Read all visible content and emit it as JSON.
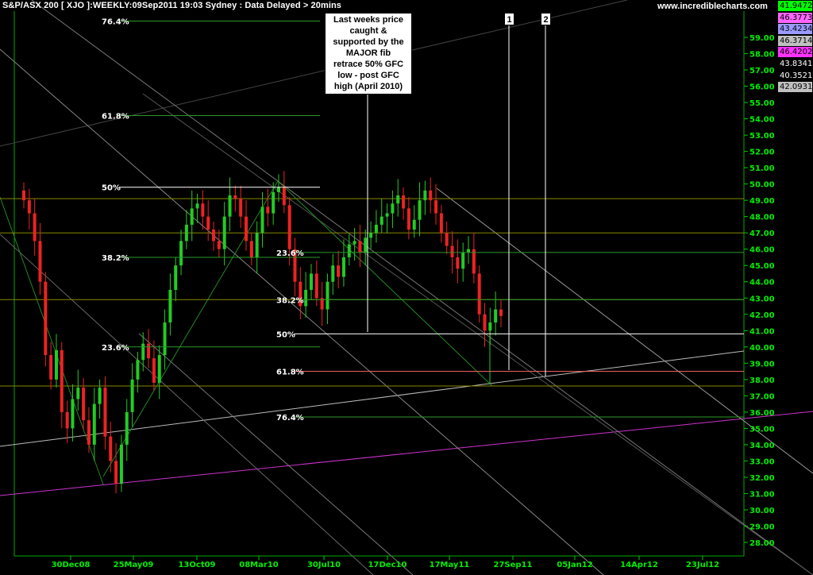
{
  "header": {
    "title": "S&P/ASX 200 [ XJO ]:WEEKLY:09Sep2011 19:03 Sydney : Data Delayed > 20mins",
    "site": "www.incrediblecharts.com"
  },
  "annotation": {
    "lines": [
      "Last weeks price",
      "caught &",
      "supported by the",
      "MAJOR fib",
      "retrace 50% GFC",
      "low - post GFC",
      "high (April 2010)"
    ]
  },
  "markers": [
    "1",
    "2"
  ],
  "price_boxes": [
    {
      "value": "41.9472",
      "color": "#00ff00"
    },
    {
      "value": "46.3773",
      "color": "#ff66ff"
    },
    {
      "value": "43.4234",
      "color": "#9999ff"
    },
    {
      "value": "46.3714",
      "color": "#c0c0c0"
    },
    {
      "value": "46.4202",
      "color": "#ff33ff"
    },
    {
      "value": "43.8341",
      "color": "#000000"
    },
    {
      "value": "40.3521",
      "color": "#000000"
    },
    {
      "value": "42.0931",
      "color": "#c0c0c0"
    }
  ],
  "chart_data": {
    "type": "candlestick",
    "ylim": [
      27.5,
      61.0
    ],
    "y_ticks": [
      "28.00",
      "29.00",
      "30.00",
      "31.00",
      "32.00",
      "33.00",
      "34.00",
      "35.00",
      "36.00",
      "37.00",
      "38.00",
      "39.00",
      "40.00",
      "41.00",
      "42.00",
      "43.00",
      "44.00",
      "45.00",
      "46.00",
      "47.00",
      "48.00",
      "49.00",
      "50.00",
      "51.00",
      "52.00",
      "53.00",
      "54.00",
      "55.00",
      "56.00",
      "57.00",
      "58.00",
      "59.00"
    ],
    "x_ticks": [
      "30Dec08",
      "25May09",
      "13Oct09",
      "08Mar10",
      "30Jul10",
      "17Dec10",
      "17May11",
      "27Sep11",
      "05Jan12",
      "14Apr12",
      "23Jul12"
    ],
    "fib_upper": [
      {
        "label": "76.4%",
        "value": 60.0
      },
      {
        "label": "61.8%",
        "value": 54.2
      },
      {
        "label": "50%",
        "value": 49.8
      },
      {
        "label": "38.2%",
        "value": 45.5
      },
      {
        "label": "23.6%",
        "value": 40.0
      }
    ],
    "fib_lower": [
      {
        "label": "23.6%",
        "value": 45.8
      },
      {
        "label": "38.2%",
        "value": 42.9
      },
      {
        "label": "50%",
        "value": 40.8
      },
      {
        "label": "61.8%",
        "value": 38.5
      },
      {
        "label": "76.4%",
        "value": 35.7
      }
    ],
    "horizontal_levels": [
      49.1,
      47.0,
      42.9,
      37.6
    ],
    "close_series": [
      49.0,
      48.2,
      46.5,
      44.0,
      39.5,
      38.0,
      39.8,
      36.0,
      35.0,
      36.8,
      37.5,
      35.5,
      34.0,
      36.5,
      37.5,
      34.5,
      33.0,
      31.6,
      34.0,
      36.0,
      38.0,
      39.2,
      40.2,
      39.3,
      37.8,
      39.5,
      41.5,
      43.5,
      45.0,
      46.5,
      47.5,
      48.5,
      48.8,
      48.0,
      47.2,
      46.5,
      46.0,
      48.0,
      49.3,
      49.1,
      48.0,
      46.5,
      45.5,
      47.0,
      48.6,
      48.2,
      49.5,
      49.8,
      48.7,
      46.0,
      44.0,
      42.5,
      43.5,
      44.5,
      43.0,
      42.3,
      44.0,
      45.0,
      44.3,
      45.5,
      46.3,
      46.5,
      45.8,
      46.7,
      47.0,
      47.5,
      48.0,
      48.2,
      48.8,
      49.3,
      48.5,
      47.2,
      47.8,
      49.0,
      49.6,
      49.0,
      48.2,
      47.0,
      46.2,
      45.5,
      44.8,
      45.8,
      46.0,
      44.5,
      42.0,
      41.0,
      41.5,
      42.3,
      41.9
    ]
  }
}
